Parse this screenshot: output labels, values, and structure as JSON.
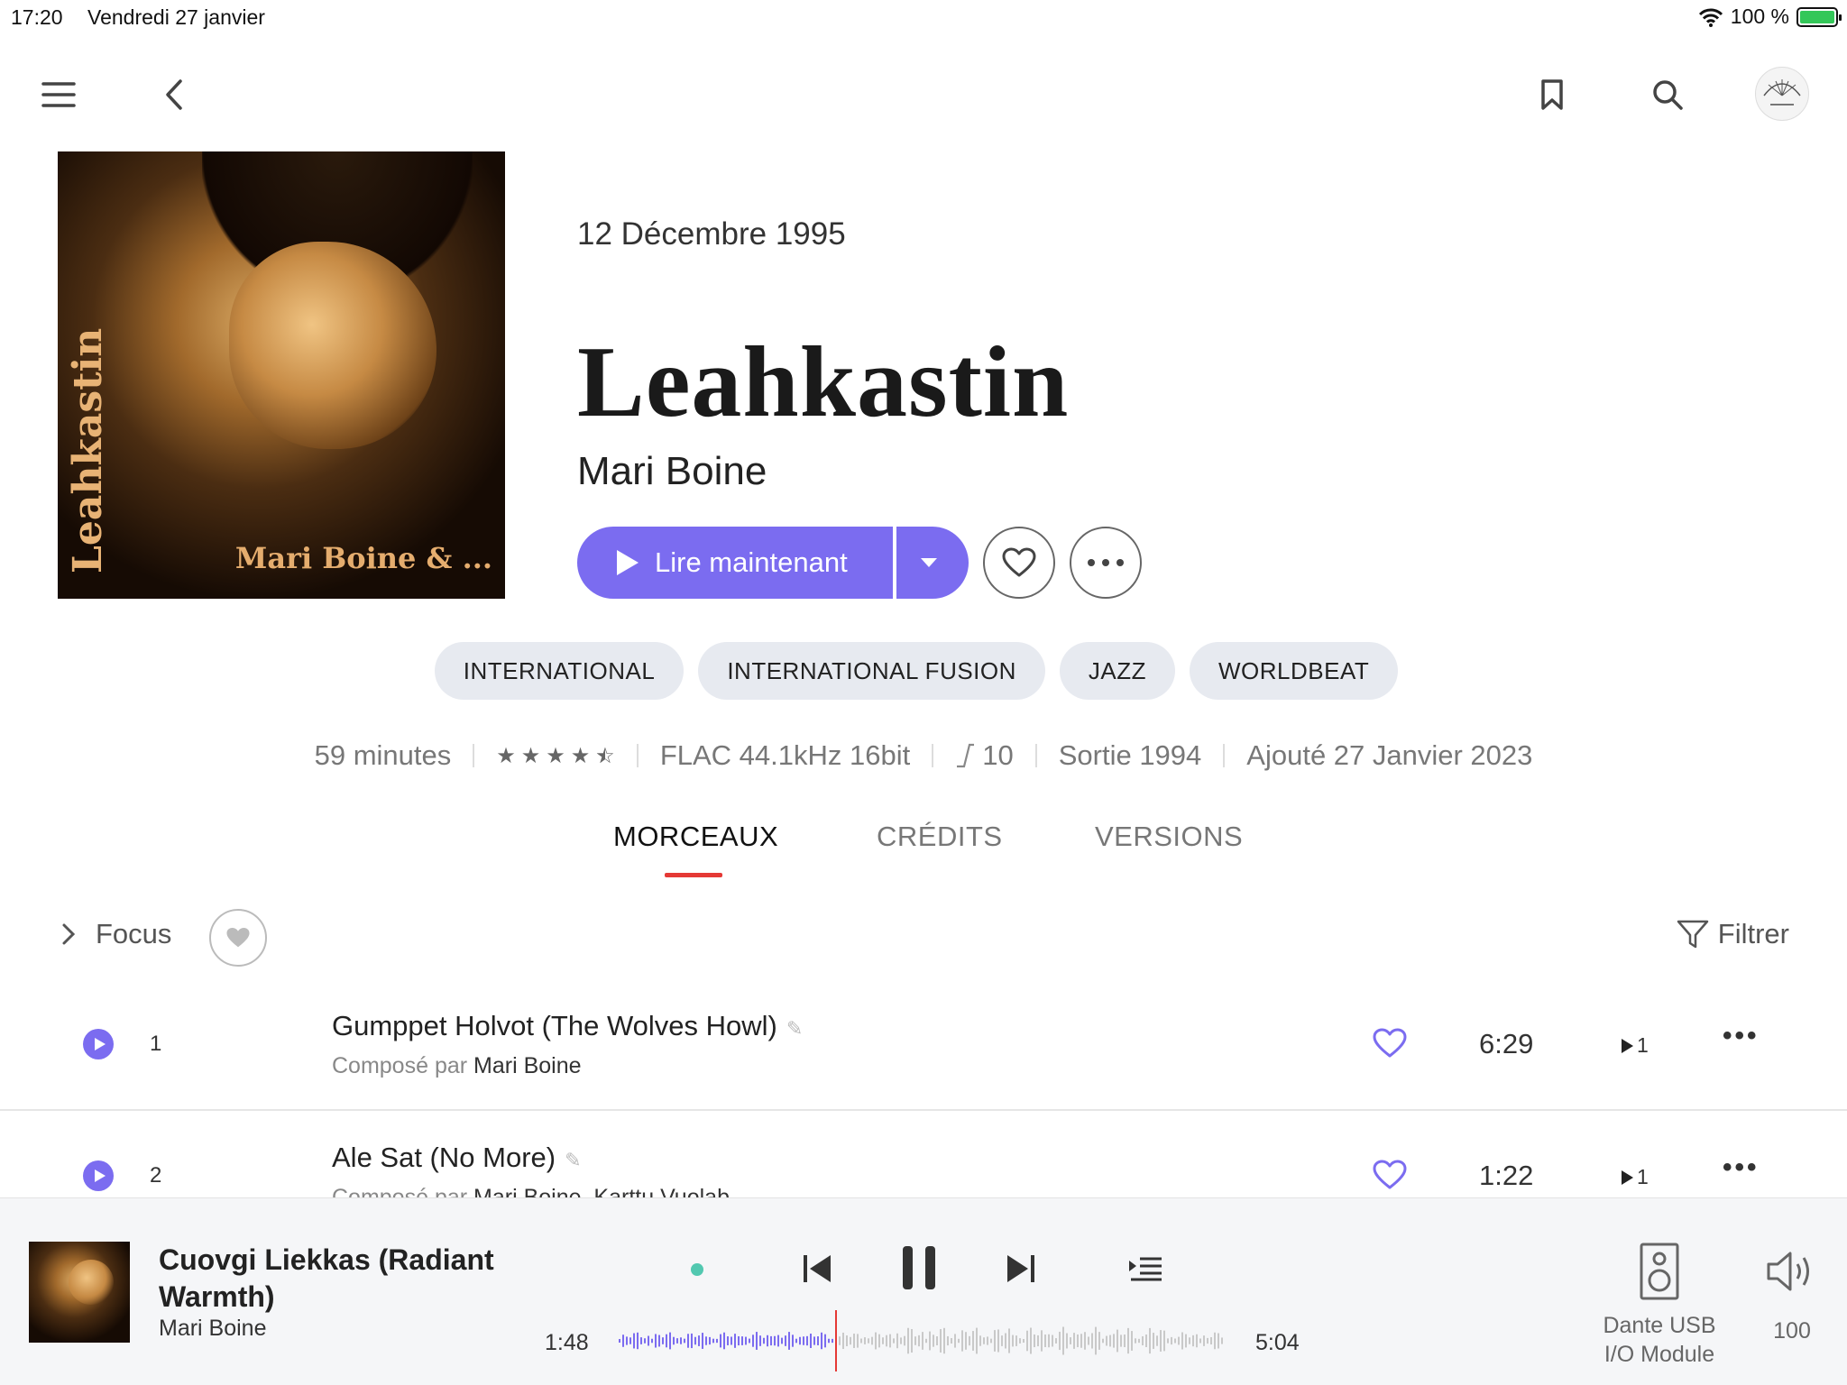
{
  "status_bar": {
    "time": "17:20",
    "date": "Vendredi 27 janvier",
    "battery": "100 %"
  },
  "icons": {
    "menu": "hamburger-icon",
    "back": "chevron-left-icon",
    "bookmark": "bookmark-icon",
    "search": "search-icon",
    "profile": "avatar"
  },
  "album": {
    "cover_title": "Leahkastin",
    "cover_artist": "Mari Boine & ...",
    "release_date": "12 Décembre 1995",
    "title": "Leahkastin",
    "artist": "Mari Boine",
    "play_label": "Lire maintenant",
    "accent": "#7b6cf0"
  },
  "genres": [
    "INTERNATIONAL",
    "INTERNATIONAL FUSION",
    "JAZZ",
    "WORLDBEAT"
  ],
  "meta": {
    "duration": "59 minutes",
    "rating": 4.5,
    "format": "FLAC 44.1kHz 16bit",
    "dynamic_range": "10",
    "sortie": "Sortie 1994",
    "added": "Ajouté 27 Janvier 2023"
  },
  "tabs": [
    {
      "label": "MORCEAUX",
      "active": true
    },
    {
      "label": "CRÉDITS",
      "active": false
    },
    {
      "label": "VERSIONS",
      "active": false
    }
  ],
  "filter_row": {
    "focus": "Focus",
    "filter": "Filtrer"
  },
  "tracks": [
    {
      "num": "1",
      "title": "Gumppet Holvot (The Wolves Howl)",
      "composed_label": "Composé par",
      "composer": "Mari Boine",
      "duration": "6:29",
      "plays": "1"
    },
    {
      "num": "2",
      "title": "Ale Sat (No More)",
      "composed_label": "Composé par",
      "composer": "Mari Boine, Karttu Vuolab",
      "duration": "1:22",
      "plays": "1"
    }
  ],
  "player": {
    "title": "Cuovgi Liekkas (Radiant Warmth)",
    "artist": "Mari Boine",
    "elapsed": "1:48",
    "total": "5:04",
    "progress": 0.356,
    "device": "Dante USB I/O Module",
    "volume": "100"
  }
}
